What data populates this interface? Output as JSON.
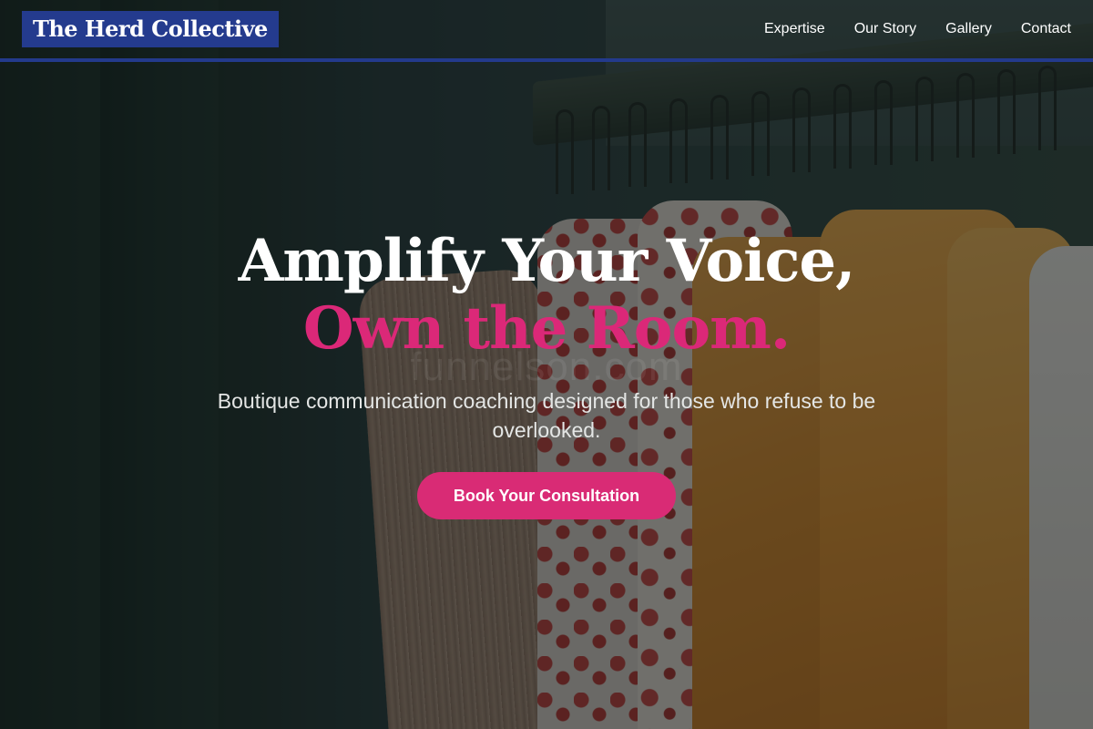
{
  "header": {
    "brand": "The Herd Collective",
    "nav": [
      "Expertise",
      "Our Story",
      "Gallery",
      "Contact"
    ]
  },
  "hero": {
    "headline_line1": "Amplify Your Voice,",
    "headline_line2": "Own the Room.",
    "tagline": "Boutique communication coaching designed for those who refuse to be overlooked.",
    "cta_label": "Book Your Consultation",
    "watermark": "funnelson.com",
    "background": "clothing rack with hanging garments"
  },
  "colors": {
    "brand_blue": "#243b8e",
    "accent_pink": "#db2878",
    "text_white": "#ffffff"
  }
}
